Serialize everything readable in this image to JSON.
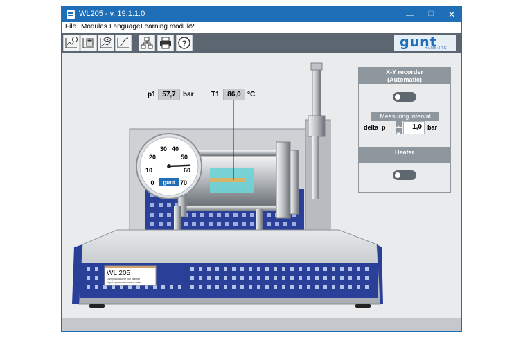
{
  "window": {
    "title": "WL205 - v. 19.1.1.0",
    "controls": {
      "minimize": "—",
      "maximize": "☐",
      "close": "✕"
    }
  },
  "menu": [
    "File",
    "Modules",
    "Language",
    "Learning module",
    "?"
  ],
  "toolbar": {
    "buttons": [
      "line-chart-clock-icon",
      "calculator-chart-icon",
      "eye-chart-icon",
      "curve-chart-icon",
      "network-diagram-icon",
      "printer-icon",
      "help-icon"
    ],
    "logo": {
      "brand": "gunt",
      "subtitle": "HAMBURG"
    }
  },
  "readouts": {
    "p1": {
      "label": "p1",
      "value": "57,7",
      "unit": "bar"
    },
    "T1": {
      "label": "T1",
      "value": "86,0",
      "unit": "°C"
    }
  },
  "gauge": {
    "ticks": [
      "0",
      "10",
      "20",
      "30",
      "40",
      "50",
      "60",
      "70"
    ],
    "brand": "gunt",
    "value": 57.7
  },
  "plate": {
    "model": "WL 205",
    "line1": "Dampfdruckkurve von Wasser",
    "line2": "Vapour pressure curve of water"
  },
  "panel": {
    "xy_title": "X-Y recorder",
    "xy_mode": "(Automatic)",
    "xy_toggle_on": false,
    "interval_title": "Measuring interval",
    "interval_param": "delta_p",
    "interval_value": "1,0",
    "interval_unit": "bar",
    "heater_title": "Heater",
    "heater_toggle_on": false
  },
  "colors": {
    "accent": "#1f6fb8",
    "panel_header": "#8e969e",
    "toolbar": "#5b6671"
  }
}
